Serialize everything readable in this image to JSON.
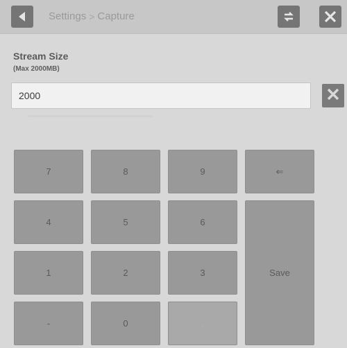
{
  "header": {
    "breadcrumb": {
      "parent": "Settings",
      "separator": ">",
      "current": "Capture"
    }
  },
  "field": {
    "title": "Stream Size",
    "subtitle": "(Max 2000MB)",
    "value": "2000"
  },
  "keypad": {
    "keys": [
      "7",
      "8",
      "9",
      "⇐",
      "4",
      "5",
      "6",
      "1",
      "2",
      "3",
      "-",
      "0",
      "."
    ],
    "save_label": "Save"
  },
  "icons": {
    "back": "back-arrow-icon",
    "swap": "swap-icon",
    "close": "close-icon",
    "clear": "clear-icon",
    "backspace": "backspace-icon"
  },
  "colors": {
    "background": "#d8d8d8",
    "header": "#c7c7c7",
    "icon_button": "#757575",
    "key": "#999999",
    "input": "#f1f1f1"
  }
}
